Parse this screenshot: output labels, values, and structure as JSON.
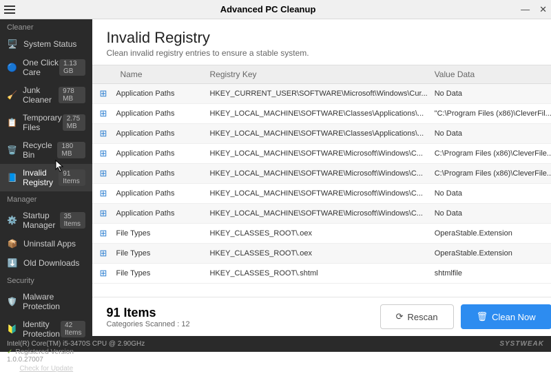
{
  "titlebar": {
    "title": "Advanced PC Cleanup"
  },
  "sidebar": {
    "sections": {
      "cleaner": "Cleaner",
      "manager": "Manager",
      "security": "Security"
    },
    "items": [
      {
        "label": "System Status",
        "badge": ""
      },
      {
        "label": "One Click Care",
        "badge": "1.13 GB"
      },
      {
        "label": "Junk Cleaner",
        "badge": "978 MB"
      },
      {
        "label": "Temporary Files",
        "badge": "2.75 MB"
      },
      {
        "label": "Recycle Bin",
        "badge": "180 MB"
      },
      {
        "label": "Invalid Registry",
        "badge": "91 Items"
      },
      {
        "label": "Startup Manager",
        "badge": "35 Items"
      },
      {
        "label": "Uninstall Apps",
        "badge": ""
      },
      {
        "label": "Old Downloads",
        "badge": ""
      },
      {
        "label": "Malware Protection",
        "badge": ""
      },
      {
        "label": "Identity Protection",
        "badge": "42 Items"
      }
    ],
    "footer": {
      "registered": "Registered Version 1.0.0.27007",
      "update": "Check for Update"
    }
  },
  "main": {
    "title": "Invalid Registry",
    "subtitle": "Clean invalid registry entries to ensure a stable system.",
    "columns": {
      "name": "Name",
      "key": "Registry Key",
      "value": "Value Data"
    },
    "rows": [
      {
        "name": "Application Paths",
        "key": "HKEY_CURRENT_USER\\SOFTWARE\\Microsoft\\Windows\\Cur...",
        "value": "No Data"
      },
      {
        "name": "Application Paths",
        "key": "HKEY_LOCAL_MACHINE\\SOFTWARE\\Classes\\Applications\\...",
        "value": "\"C:\\Program Files (x86)\\CleverFil..."
      },
      {
        "name": "Application Paths",
        "key": "HKEY_LOCAL_MACHINE\\SOFTWARE\\Classes\\Applications\\...",
        "value": "No Data"
      },
      {
        "name": "Application Paths",
        "key": "HKEY_LOCAL_MACHINE\\SOFTWARE\\Microsoft\\Windows\\C...",
        "value": "C:\\Program Files (x86)\\CleverFile..."
      },
      {
        "name": "Application Paths",
        "key": "HKEY_LOCAL_MACHINE\\SOFTWARE\\Microsoft\\Windows\\C...",
        "value": "C:\\Program Files (x86)\\CleverFile..."
      },
      {
        "name": "Application Paths",
        "key": "HKEY_LOCAL_MACHINE\\SOFTWARE\\Microsoft\\Windows\\C...",
        "value": "No Data"
      },
      {
        "name": "Application Paths",
        "key": "HKEY_LOCAL_MACHINE\\SOFTWARE\\Microsoft\\Windows\\C...",
        "value": "No Data"
      },
      {
        "name": "File Types",
        "key": "HKEY_CLASSES_ROOT\\.oex",
        "value": "OperaStable.Extension"
      },
      {
        "name": "File Types",
        "key": "HKEY_CLASSES_ROOT\\.oex",
        "value": "OperaStable.Extension"
      },
      {
        "name": "File Types",
        "key": "HKEY_CLASSES_ROOT\\.shtml",
        "value": "shtmlfile"
      }
    ],
    "summary": {
      "count": "91",
      "items_label": "Items",
      "categories": "Categories Scanned : 12"
    },
    "buttons": {
      "rescan": "Rescan",
      "clean": "Clean Now"
    }
  },
  "statusbar": {
    "cpu": "Intel(R) Core(TM) i5-3470S CPU @ 2.90GHz",
    "brand": "SYSTWEAK"
  }
}
